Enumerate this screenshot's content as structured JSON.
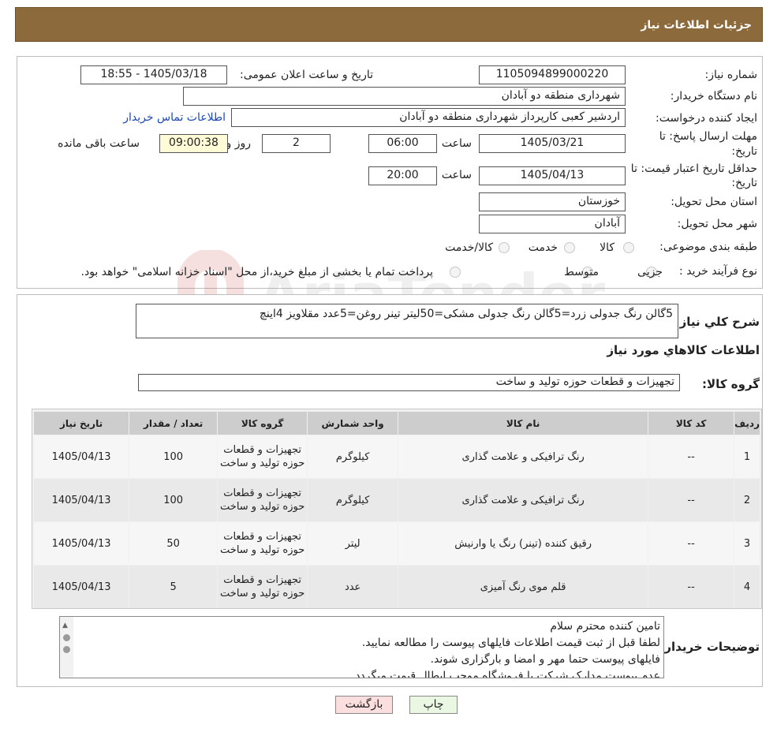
{
  "page": {
    "title": "جزئیات اطلاعات نیاز"
  },
  "info": {
    "need_number_label": "شماره نیاز:",
    "need_number": "1105094899000220",
    "announce_label": "تاریخ و ساعت اعلان عمومی:",
    "announce_value": "1405/03/18 - 18:55",
    "buyer_label": "نام دستگاه خریدار:",
    "buyer_value": "شهرداری منطقه دو آبادان",
    "creator_label": "ایجاد کننده درخواست:",
    "creator_value": "اردشیر کعبی کارپرداز شهرداری منطقه دو آبادان",
    "contact_link": "اطلاعات تماس خریدار",
    "deadline_label_1": "مهلت ارسال پاسخ: تا",
    "deadline_label_2": "تاریخ:",
    "deadline_date": "1405/03/21",
    "time_label": "ساعت",
    "deadline_time": "06:00",
    "days_value": "2",
    "days_label": "روز و",
    "remaining_time": "09:00:38",
    "remaining_label": "ساعت باقی مانده",
    "validity_label_1": "حداقل تاریخ اعتبار قیمت: تا",
    "validity_label_2": "تاریخ:",
    "validity_date": "1405/04/13",
    "validity_time": "20:00",
    "province_label": "استان محل تحویل:",
    "province_value": "خوزستان",
    "city_label": "شهر محل تحویل:",
    "city_value": "آبادان",
    "category_label": "طبقه بندی موضوعی:",
    "category_options": [
      "کالا",
      "خدمت",
      "کالا/خدمت"
    ],
    "process_label": "نوع فرآیند خرید :",
    "process_options": [
      "جزیی",
      "متوسط"
    ],
    "process_note": "پرداخت تمام یا بخشی از مبلغ خرید،از محل \"اسناد خزانه اسلامی\" خواهد بود."
  },
  "summary": {
    "label": "شرح کلي نياز:",
    "value": "5گالن رنگ جدولی زرد=5گالن رنگ جدولی مشکی=50لیتر تینر روغن=5عدد مقلاویز 4اینچ"
  },
  "goods": {
    "section_title": "اطلاعات کالاهاي مورد نياز",
    "group_label": "گروه کالا:",
    "group_value": "تجهیزات و قطعات حوزه تولید و ساخت",
    "columns": [
      "ردیف",
      "کد کالا",
      "نام کالا",
      "واحد شمارش",
      "گروه کالا",
      "تعداد / مقدار",
      "تاریخ نیاز"
    ],
    "rows": [
      {
        "row": "1",
        "code": "--",
        "name": "رنگ ترافیکی و علامت گذاری",
        "unit": "کیلوگرم",
        "group": "تجهیزات و قطعات حوزه تولید و ساخت",
        "qty": "100",
        "date": "1405/04/13"
      },
      {
        "row": "2",
        "code": "--",
        "name": "رنگ ترافیکی و علامت گذاری",
        "unit": "کیلوگرم",
        "group": "تجهیزات و قطعات حوزه تولید و ساخت",
        "qty": "100",
        "date": "1405/04/13"
      },
      {
        "row": "3",
        "code": "--",
        "name": "رقیق کننده (تینر) رنگ یا وارنیش",
        "unit": "لیتر",
        "group": "تجهیزات و قطعات حوزه تولید و ساخت",
        "qty": "50",
        "date": "1405/04/13"
      },
      {
        "row": "4",
        "code": "--",
        "name": "قلم موی رنگ آمیزی",
        "unit": "عدد",
        "group": "تجهیزات و قطعات حوزه تولید و ساخت",
        "qty": "5",
        "date": "1405/04/13"
      }
    ]
  },
  "notes": {
    "label": "توضیحات خریدار:",
    "lines": [
      "تامین کننده محترم سلام",
      "لطفا قبل از ثبت قیمت اطلاعات فایلهای پیوست را مطالعه نمایید.",
      "فایلهای پیوست حتما مهر و امضا و بارگزاری شوند.",
      "عدم پیوست مدارک شرکت یا فروشگاه موجب ابطال قیمت میگردد."
    ]
  },
  "buttons": {
    "print": "چاپ",
    "back": "بازگشت"
  },
  "watermark": {
    "text": "AriaTender.neT"
  }
}
